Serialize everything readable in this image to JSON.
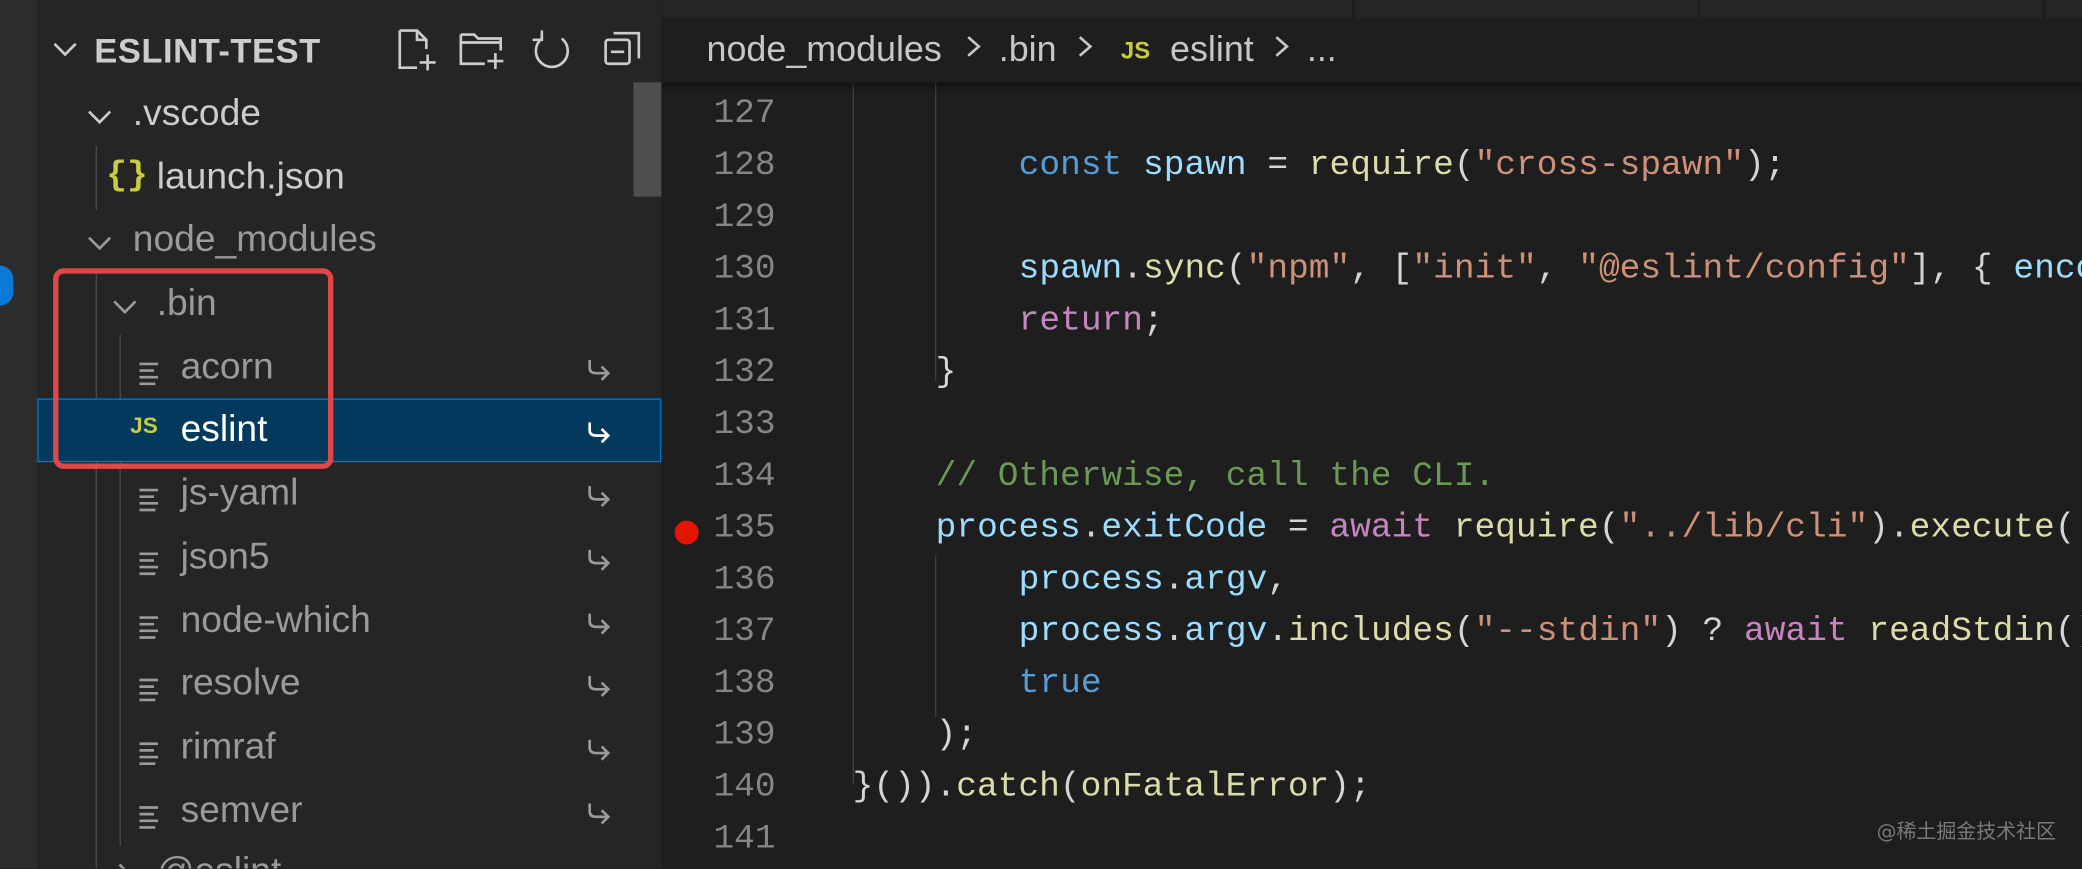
{
  "explorer": {
    "title": "ESLINT-TEST",
    "actions": [
      {
        "name": "new-file-icon"
      },
      {
        "name": "new-folder-icon"
      },
      {
        "name": "refresh-icon"
      },
      {
        "name": "collapse-all-icon"
      }
    ],
    "tree": [
      {
        "label": ".vscode",
        "type": "folder"
      },
      {
        "label": "launch.json",
        "type": "json"
      },
      {
        "label": "node_modules",
        "type": "folder"
      },
      {
        "label": ".bin",
        "type": "folder"
      },
      {
        "label": "acorn",
        "type": "file"
      },
      {
        "label": "eslint",
        "type": "js",
        "selected": true
      },
      {
        "label": "js-yaml",
        "type": "file"
      },
      {
        "label": "json5",
        "type": "file"
      },
      {
        "label": "node-which",
        "type": "file"
      },
      {
        "label": "resolve",
        "type": "file"
      },
      {
        "label": "rimraf",
        "type": "file"
      },
      {
        "label": "semver",
        "type": "file"
      },
      {
        "label": "@eslint",
        "type": "folder"
      }
    ],
    "json_icon": "{}",
    "js_icon": "JS"
  },
  "breadcrumb": {
    "parts": [
      "node_modules",
      ".bin",
      "eslint",
      "..."
    ],
    "js_icon": "JS"
  },
  "editor": {
    "breakpoint_line": 135,
    "lines": [
      {
        "n": "127",
        "tokens": []
      },
      {
        "n": "128",
        "tokens": [
          {
            "t": "const",
            "c": "kw"
          },
          {
            "t": " "
          },
          {
            "t": "spawn",
            "c": "var"
          },
          {
            "t": " = "
          },
          {
            "t": "require",
            "c": "fn"
          },
          {
            "t": "("
          },
          {
            "t": "\"cross-spawn\"",
            "c": "str"
          },
          {
            "t": ");"
          }
        ]
      },
      {
        "n": "129",
        "tokens": []
      },
      {
        "n": "130",
        "tokens": [
          {
            "t": "spawn",
            "c": "var"
          },
          {
            "t": "."
          },
          {
            "t": "sync",
            "c": "fn"
          },
          {
            "t": "("
          },
          {
            "t": "\"npm\"",
            "c": "str"
          },
          {
            "t": ", ["
          },
          {
            "t": "\"init\"",
            "c": "str"
          },
          {
            "t": ", "
          },
          {
            "t": "\"@eslint/config\"",
            "c": "str"
          },
          {
            "t": "], { "
          },
          {
            "t": "encoding",
            "c": "var"
          }
        ]
      },
      {
        "n": "131",
        "tokens": [
          {
            "t": "return",
            "c": "ctl"
          },
          {
            "t": ";"
          }
        ]
      },
      {
        "n": "132",
        "tokens": [
          {
            "t": "}"
          }
        ]
      },
      {
        "n": "133",
        "tokens": []
      },
      {
        "n": "134",
        "tokens": [
          {
            "t": "// Otherwise, call the CLI.",
            "c": "cmt"
          }
        ]
      },
      {
        "n": "135",
        "tokens": [
          {
            "t": "process",
            "c": "var"
          },
          {
            "t": "."
          },
          {
            "t": "exitCode",
            "c": "var"
          },
          {
            "t": " = "
          },
          {
            "t": "await",
            "c": "ctl"
          },
          {
            "t": " "
          },
          {
            "t": "require",
            "c": "fn"
          },
          {
            "t": "("
          },
          {
            "t": "\"../lib/cli\"",
            "c": "str"
          },
          {
            "t": ")."
          },
          {
            "t": "execute",
            "c": "fn"
          },
          {
            "t": "("
          }
        ]
      },
      {
        "n": "136",
        "tokens": [
          {
            "t": "process",
            "c": "var"
          },
          {
            "t": "."
          },
          {
            "t": "argv",
            "c": "var"
          },
          {
            "t": ","
          }
        ]
      },
      {
        "n": "137",
        "tokens": [
          {
            "t": "process",
            "c": "var"
          },
          {
            "t": "."
          },
          {
            "t": "argv",
            "c": "var"
          },
          {
            "t": "."
          },
          {
            "t": "includes",
            "c": "fn"
          },
          {
            "t": "("
          },
          {
            "t": "\"--stdin\"",
            "c": "str"
          },
          {
            "t": ") ? "
          },
          {
            "t": "await",
            "c": "ctl"
          },
          {
            "t": " "
          },
          {
            "t": "readStdin",
            "c": "fn"
          },
          {
            "t": "()"
          }
        ]
      },
      {
        "n": "138",
        "tokens": [
          {
            "t": "true",
            "c": "kw"
          }
        ]
      },
      {
        "n": "139",
        "tokens": [
          {
            "t": ");"
          }
        ]
      },
      {
        "n": "140",
        "tokens": [
          {
            "t": "}())."
          },
          {
            "t": "catch",
            "c": "fn"
          },
          {
            "t": "("
          },
          {
            "t": "onFatalError",
            "c": "fn"
          },
          {
            "t": ");"
          }
        ]
      },
      {
        "n": "141",
        "tokens": []
      }
    ]
  },
  "watermark": "@稀土掘金技术社区",
  "colors": {
    "selection": "#04395e",
    "highlight_box": "#e04848",
    "breakpoint": "#e51400",
    "js_icon": "#cbcb41"
  }
}
